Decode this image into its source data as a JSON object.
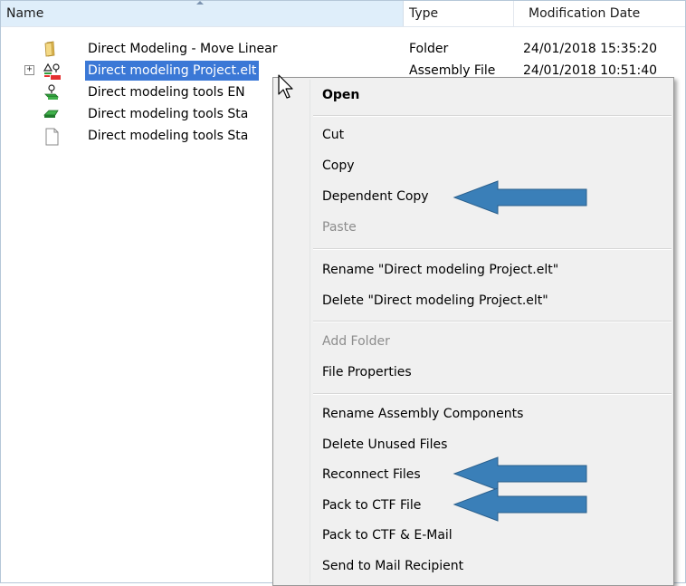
{
  "header": {
    "name": "Name",
    "type": "Type",
    "date": "Modification Date"
  },
  "rows": [
    {
      "name": "Direct Modeling - Move Linear",
      "type": "Folder",
      "date": "24/01/2018 15:35:20",
      "icon": "folder-icon"
    },
    {
      "name": "Direct modeling Project.elt",
      "type": "Assembly File",
      "date": "24/01/2018 10:51:40",
      "icon": "assembly-icon",
      "selected": true,
      "expander": "+"
    },
    {
      "name": "Direct modeling tools EN",
      "type": "",
      "date": "",
      "icon": "part-icon"
    },
    {
      "name": "Direct modeling tools Sta",
      "type": "",
      "date": "",
      "icon": "sheetmetal-icon"
    },
    {
      "name": "Direct modeling tools Sta",
      "type": "",
      "date": "",
      "icon": "document-icon"
    }
  ],
  "menu": {
    "open": "Open",
    "cut": "Cut",
    "copy": "Copy",
    "dependent_copy": "Dependent Copy",
    "paste": "Paste",
    "rename": "Rename \"Direct modeling Project.elt\"",
    "delete": "Delete \"Direct modeling Project.elt\"",
    "add_folder": "Add Folder",
    "file_properties": "File Properties",
    "rename_assembly": "Rename Assembly Components",
    "delete_unused": "Delete Unused Files",
    "reconnect": "Reconnect Files",
    "pack_ctf": "Pack to CTF File",
    "pack_ctf_email": "Pack to CTF & E-Mail",
    "send_mail": "Send to Mail Recipient"
  },
  "colors": {
    "selection": "#3b78d6",
    "annotation_arrow": "#3a7fb8",
    "header_name_bg": "#dfeefa"
  }
}
